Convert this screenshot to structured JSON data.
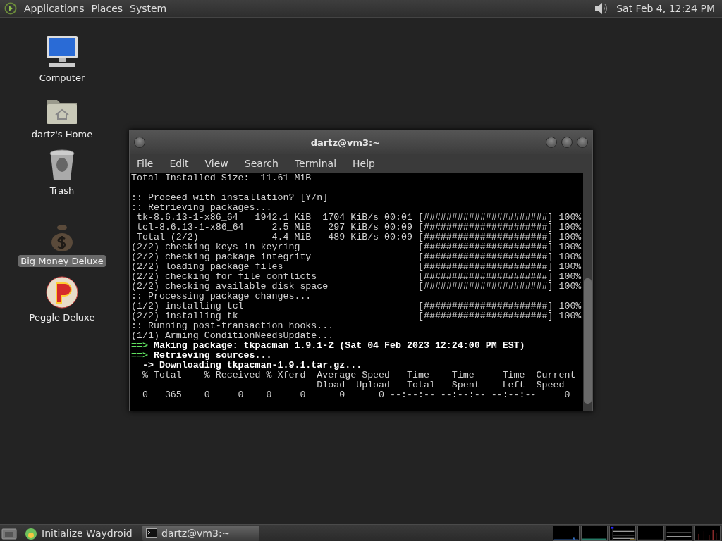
{
  "top_panel": {
    "menus": [
      "Applications",
      "Places",
      "System"
    ],
    "clock": "Sat Feb 4, 12:24 PM"
  },
  "desktop_icons": [
    {
      "label": "Computer",
      "kind": "computer",
      "selected": false
    },
    {
      "label": "dartz's Home",
      "kind": "home",
      "selected": false
    },
    {
      "label": "Trash",
      "kind": "trash",
      "selected": false
    },
    {
      "label": "Big Money Deluxe",
      "kind": "moneybag",
      "selected": true
    },
    {
      "label": "Peggle Deluxe",
      "kind": "peggle",
      "selected": false
    }
  ],
  "terminal_window": {
    "title": "dartz@vm3:~",
    "menu": [
      "File",
      "Edit",
      "View",
      "Search",
      "Terminal",
      "Help"
    ],
    "lines": [
      {
        "kind": "plain",
        "text": "Total Installed Size:  11.61 MiB"
      },
      {
        "kind": "blank"
      },
      {
        "kind": "plain",
        "text": ":: Proceed with installation? [Y/n]"
      },
      {
        "kind": "plain",
        "text": ":: Retrieving packages..."
      },
      {
        "kind": "progress",
        "text": " tk-8.6.13-1-x86_64   1942.1 KiB  1704 KiB/s 00:01",
        "bar": "[######################]",
        "percent": "100%"
      },
      {
        "kind": "progress",
        "text": " tcl-8.6.13-1-x86_64     2.5 MiB   297 KiB/s 00:09",
        "bar": "[######################]",
        "percent": "100%"
      },
      {
        "kind": "progress",
        "text": " Total (2/2)             4.4 MiB   489 KiB/s 00:09",
        "bar": "[######################]",
        "percent": "100%"
      },
      {
        "kind": "progress",
        "text": "(2/2) checking keys in keyring",
        "bar": "[######################]",
        "percent": "100%"
      },
      {
        "kind": "progress",
        "text": "(2/2) checking package integrity",
        "bar": "[######################]",
        "percent": "100%"
      },
      {
        "kind": "progress",
        "text": "(2/2) loading package files",
        "bar": "[######################]",
        "percent": "100%"
      },
      {
        "kind": "progress",
        "text": "(2/2) checking for file conflicts",
        "bar": "[######################]",
        "percent": "100%"
      },
      {
        "kind": "progress",
        "text": "(2/2) checking available disk space",
        "bar": "[######################]",
        "percent": "100%"
      },
      {
        "kind": "plain",
        "text": ":: Processing package changes..."
      },
      {
        "kind": "progress",
        "text": "(1/2) installing tcl",
        "bar": "[######################]",
        "percent": "100%"
      },
      {
        "kind": "progress",
        "text": "(2/2) installing tk",
        "bar": "[######################]",
        "percent": "100%"
      },
      {
        "kind": "plain",
        "text": ":: Running post-transaction hooks..."
      },
      {
        "kind": "plain",
        "text": "(1/1) Arming ConditionNeedsUpdate..."
      },
      {
        "kind": "heading",
        "prefix": "==>",
        "text": "Making package: tkpacman 1.9.1-2 (Sat 04 Feb 2023 12:24:00 PM EST)"
      },
      {
        "kind": "heading",
        "prefix": "==>",
        "text": "Retrieving sources..."
      },
      {
        "kind": "bold",
        "text": "  -> Downloading tkpacman-1.9.1.tar.gz..."
      },
      {
        "kind": "plain",
        "text": "  % Total    % Received % Xferd  Average Speed   Time    Time     Time  Current"
      },
      {
        "kind": "plain",
        "text": "                                 Dload  Upload   Total   Spent    Left  Speed"
      },
      {
        "kind": "plain",
        "text": "  0   365    0     0    0     0      0      0 --:--:-- --:--:-- --:--:--     0"
      }
    ]
  },
  "taskbar": [
    {
      "label": "Initialize Waydroid",
      "kind": "waydroid",
      "selected": false
    },
    {
      "label": "dartz@vm3:~",
      "kind": "terminal",
      "selected": true
    }
  ]
}
